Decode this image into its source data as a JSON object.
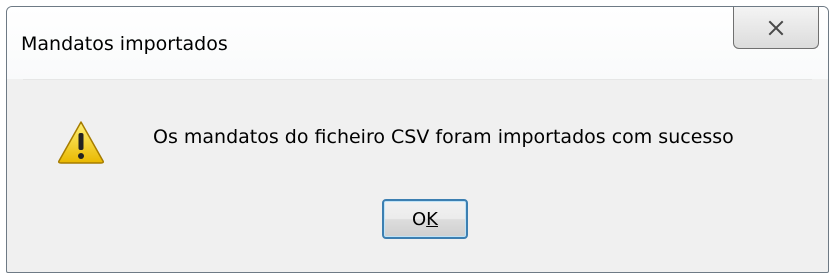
{
  "dialog": {
    "title": "Mandatos importados",
    "message": "Os mandatos do ficheiro CSV foram importados com sucesso",
    "ok_label_first": "O",
    "ok_label_mnemonic": "K",
    "close_icon": "close-icon",
    "message_icon": "warning-icon"
  },
  "colors": {
    "dialog_background": "#f0f0f0",
    "warning_fill": "#f5d21a",
    "ok_button_border": "#3c7fb1"
  }
}
